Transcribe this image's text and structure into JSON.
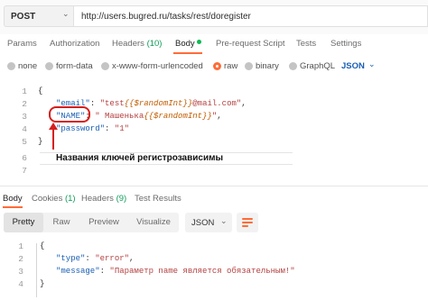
{
  "request": {
    "method": "POST",
    "url": "http://users.bugred.ru/tasks/rest/doregister"
  },
  "tabs": [
    {
      "label": "Params"
    },
    {
      "label": "Authorization"
    },
    {
      "label": "Headers",
      "count": "(10)"
    },
    {
      "label": "Body"
    },
    {
      "label": "Pre-request Script"
    },
    {
      "label": "Tests"
    },
    {
      "label": "Settings"
    }
  ],
  "body_types": {
    "options": [
      "none",
      "form-data",
      "x-www-form-urlencoded",
      "raw",
      "binary",
      "GraphQL"
    ],
    "selected": "raw",
    "format": "JSON"
  },
  "editor": {
    "line_numbers": [
      "1",
      "2",
      "3",
      "4",
      "5",
      "6",
      "7"
    ],
    "lines": {
      "l1": "{",
      "l2_key": "\"email\"",
      "l2_colon": ": ",
      "l2_val_a": "\"test",
      "l2_var": "{{$randomInt}}",
      "l2_val_b": "@mail.com\"",
      "l2_end": ",",
      "l3_key": "\"NAME\"",
      "l3_colon": ": ",
      "l3_val_a": "\" Машенька",
      "l3_var": "{{$randomInt}}",
      "l3_val_b": "\"",
      "l3_end": ",",
      "l4_key": "\"password\"",
      "l4_colon": ": ",
      "l4_val": "\"1\"",
      "l5": "}"
    },
    "annotation": "Названия ключей регистрозависимы"
  },
  "response": {
    "tabs": [
      {
        "label": "Body"
      },
      {
        "label": "Cookies",
        "count": "(1)"
      },
      {
        "label": "Headers",
        "count": "(9)"
      },
      {
        "label": "Test Results"
      }
    ],
    "views": [
      "Pretty",
      "Raw",
      "Preview",
      "Visualize"
    ],
    "active_view": "Pretty",
    "format": "JSON",
    "line_numbers": [
      "1",
      "2",
      "3",
      "4"
    ],
    "lines": {
      "l1": "{",
      "l2_key": "\"type\"",
      "l2_val": "\"error\"",
      "l3_key": "\"message\"",
      "l3_val": "\"Параметр name является обязательным!\"",
      "l4": "}"
    }
  },
  "colors": {
    "accent": "#ff6c37",
    "annotation_red": "#d51e1e",
    "json_key": "#1a5fb4",
    "json_string": "#b54040",
    "status_green": "#0cbb52"
  }
}
